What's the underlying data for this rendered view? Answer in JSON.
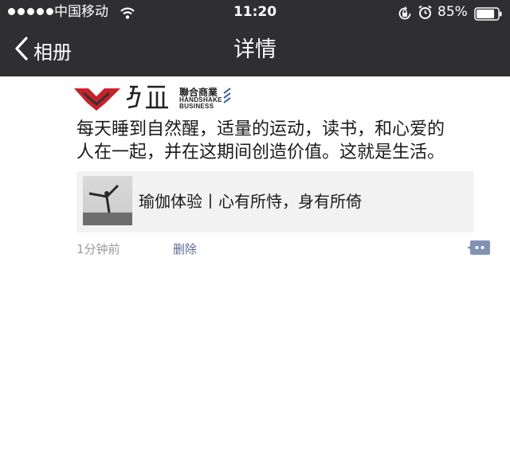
{
  "status_bar": {
    "carrier": "中国移动",
    "time": "11:20",
    "battery_percent": "85%",
    "battery_level": 0.85,
    "signal_bars": 5,
    "icons": [
      "wifi-icon",
      "rotation-lock-icon",
      "alarm-icon",
      "battery-icon"
    ]
  },
  "nav": {
    "back_label": "相册",
    "title": "详情"
  },
  "logo": {
    "cn": "聯合商業",
    "en_line1": "HANDSHAKE",
    "en_line2": "BUSINESS"
  },
  "post": {
    "text_line1": "每天睡到自然醒，适量的运动，读书，和心爱的",
    "text_line2": "人在一起，并在这期间创造价值。这就是生活。",
    "link_title": "瑜伽体验丨心有所恃，身有所倚",
    "time": "1分钟前",
    "delete_label": "删除"
  },
  "colors": {
    "header_bg": "#2f2f31",
    "link_blue": "#5b6b94",
    "comment_icon": "#8192b5",
    "logo_red": "#c8212b"
  }
}
